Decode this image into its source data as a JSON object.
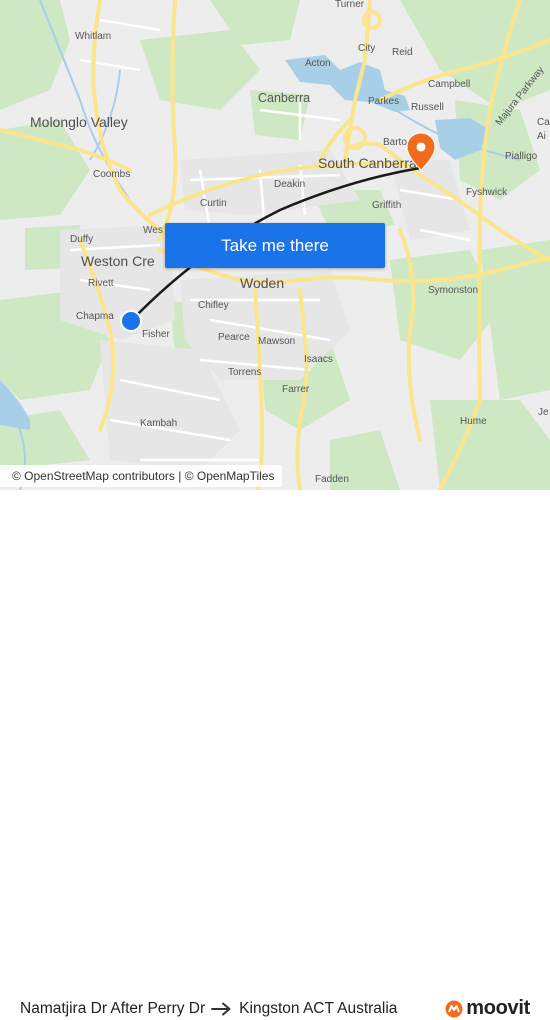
{
  "map": {
    "labels": {
      "turner": "Turner",
      "whitlam": "Whitlam",
      "city": "City",
      "reid": "Reid",
      "acton": "Acton",
      "campbell": "Campbell",
      "majura_parkway": "Majura Parkway",
      "molonglo_valley": "Molonglo Valley",
      "canberra": "Canberra",
      "parkes": "Parkes",
      "russell": "Russell",
      "ca": "Ca",
      "ai": "Ai",
      "barton": "Barto",
      "pialligo": "Pialligo",
      "coombs": "Coombs",
      "south_canberra": "South Canberra",
      "deakin": "Deakin",
      "fyshwick": "Fyshwick",
      "curtin": "Curtin",
      "griffith": "Griffith",
      "duffy": "Duffy",
      "weston": "Wes",
      "weston_creek": "Weston Cre",
      "rivett": "Rivett",
      "woden": "Woden",
      "symonston": "Symonston",
      "chifley": "Chifley",
      "chapman": "Chapma",
      "fisher": "Fisher",
      "pearce": "Pearce",
      "mawson": "Mawson",
      "isaacs": "Isaacs",
      "torrens": "Torrens",
      "farrer": "Farrer",
      "kambah": "Kambah",
      "hume": "Hume",
      "je": "Je",
      "fadden": "Fadden"
    },
    "cta_label": "Take me there",
    "attribution": "© OpenStreetMap contributors | © OpenMapTiles",
    "colors": {
      "water": "#a8cfe8",
      "park": "#cfe8c4",
      "road_major": "#fbe58c",
      "route": "#1a1a1a",
      "origin": "#1a73e8",
      "destination": "#f26b1d"
    }
  },
  "footer": {
    "origin": "Namatjira Dr After Perry Dr",
    "destination": "Kingston ACT Australia",
    "brand": "moovit"
  }
}
